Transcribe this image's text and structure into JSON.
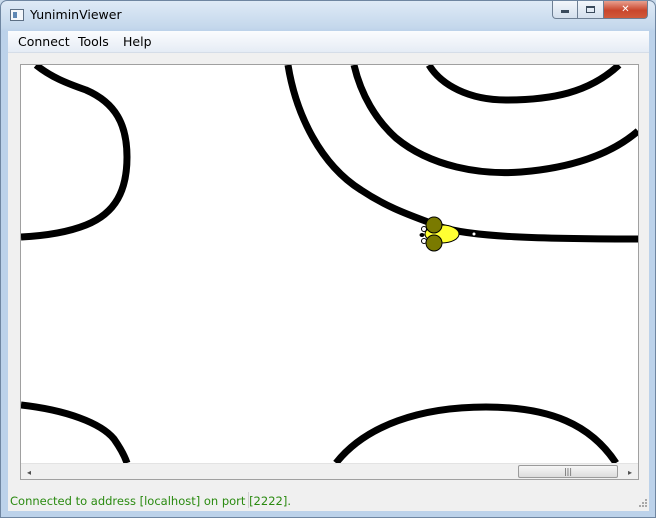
{
  "window": {
    "title": "YuniminViewer",
    "close_glyph": "✕"
  },
  "menu": {
    "items": [
      "Connect",
      "Tools",
      "Help"
    ]
  },
  "scrollbar": {
    "left_arrow": "◂",
    "right_arrow": "▸",
    "thumb_grip": "|||"
  },
  "status": {
    "text": "Connected to address [localhost] on port [2222].",
    "color": "#2a8a10"
  },
  "colors": {
    "track": "#000000",
    "robot_body": "#ffff33",
    "robot_wheel": "#7a7a00"
  },
  "icons": {
    "app": "app-window-icon",
    "minimize": "minimize-icon",
    "maximize": "maximize-icon",
    "close": "close-icon",
    "robot": "robot-mouse-icon"
  }
}
